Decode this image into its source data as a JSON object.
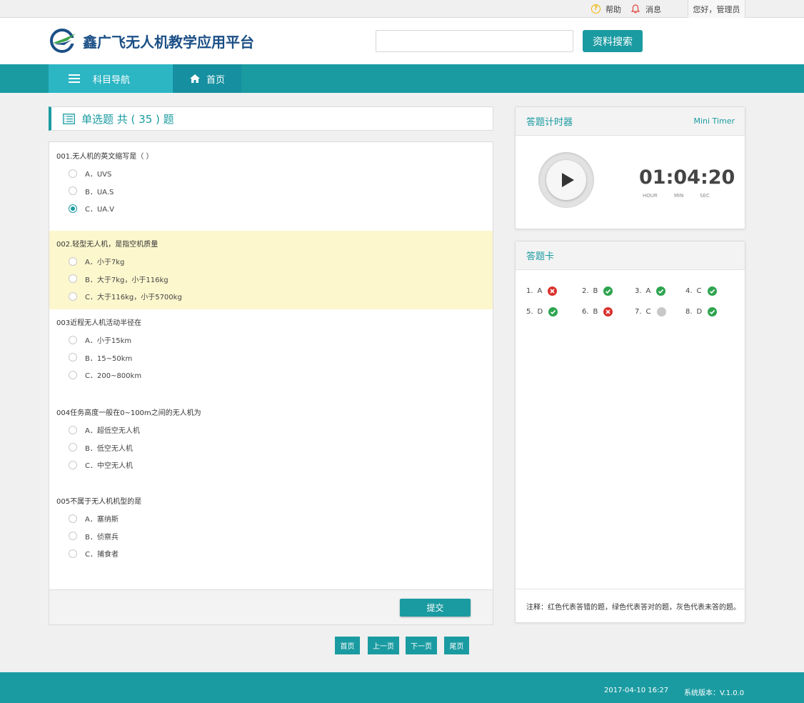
{
  "topbar": {
    "help_label": "帮助",
    "messages_label": "消息",
    "greeting": "您好，管理员"
  },
  "header": {
    "logo_title": "鑫广飞无人机教学应用平台",
    "search_placeholder": "",
    "search_button": "资料搜索"
  },
  "nav": {
    "menu_label": "科目导航",
    "home_label": "首页"
  },
  "quiz": {
    "title": "单选题 共 ( 35 ) 题",
    "questions": [
      {
        "text": "001.无人机的英文缩写是（  ）",
        "options": [
          "A．UVS",
          "B．UA.S",
          "C．UA.V"
        ],
        "selected": 2,
        "highlighted": false
      },
      {
        "text": "002.轻型无人机，是指空机质量",
        "options": [
          "A．小于7kg",
          "B．大于7kg，小于116kg",
          "C．大于116kg，小于5700kg"
        ],
        "selected": null,
        "highlighted": true
      },
      {
        "text": "003近程无人机活动半径在",
        "options": [
          "A．小于15km",
          "B．15~50km",
          "C．200~800km"
        ],
        "selected": null,
        "highlighted": false
      },
      {
        "text": "004任务高度一般在0~100m之间的无人机为",
        "options": [
          "A．超低空无人机",
          "B．低空无人机",
          "C．中空无人机"
        ],
        "selected": null,
        "highlighted": false
      },
      {
        "text": "005不属于无人机机型的是",
        "options": [
          "A．塞纳斯",
          "B．侦察兵",
          "C．捕食者"
        ],
        "selected": null,
        "highlighted": false
      }
    ],
    "submit_label": "提交"
  },
  "pager": {
    "first": "首页",
    "prev": "上一页",
    "next": "下一页",
    "last": "尾页"
  },
  "timer": {
    "title": "答题计时器",
    "mini_label": "Mini Timer",
    "value": "01:04:20",
    "hour_label": "HOUR",
    "min_label": "MIN",
    "sec_label": "SEC"
  },
  "answer_card": {
    "title": "答题卡",
    "items": [
      {
        "num": "1.",
        "answer": "A",
        "status": "wrong"
      },
      {
        "num": "2.",
        "answer": "B",
        "status": "correct"
      },
      {
        "num": "3.",
        "answer": "A",
        "status": "correct"
      },
      {
        "num": "4.",
        "answer": "C",
        "status": "correct"
      },
      {
        "num": "5.",
        "answer": "D",
        "status": "correct"
      },
      {
        "num": "6.",
        "answer": "B",
        "status": "wrong"
      },
      {
        "num": "7.",
        "answer": "C",
        "status": "unanswered"
      },
      {
        "num": "8.",
        "answer": "D",
        "status": "correct"
      }
    ],
    "note": "注释：红色代表答错的题，绿色代表答对的题，灰色代表未答的题。"
  },
  "footer": {
    "datetime": "2017-04-10  16:27",
    "version": "系统版本：V.1.0.0"
  },
  "colors": {
    "primary": "#1a9ba1",
    "nav_active": "#2cb6c4",
    "highlight_row": "#fcf7cd",
    "correct": "#2ea44f",
    "wrong": "#d9302c",
    "unanswered": "#c8c8c8"
  }
}
